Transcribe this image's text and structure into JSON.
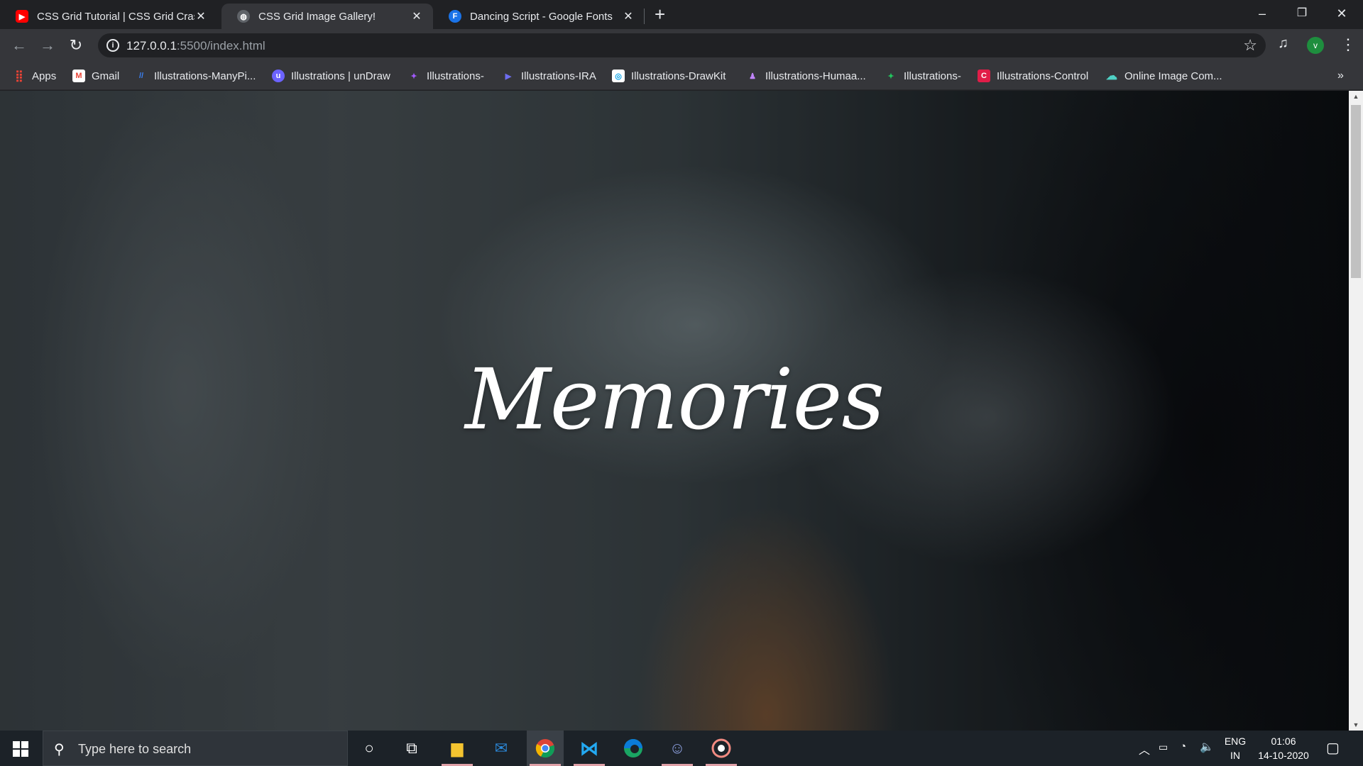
{
  "browser": {
    "tabs": [
      {
        "title": "CSS Grid Tutorial | CSS Grid Crash",
        "favicon": "youtube-icon",
        "favicon_color": "#ff0000",
        "active": false
      },
      {
        "title": "CSS Grid Image Gallery!",
        "favicon": "globe-icon",
        "favicon_color": "#5f6368",
        "active": true
      },
      {
        "title": "Dancing Script - Google Fonts",
        "favicon": "google-fonts-icon",
        "favicon_color": "#1a73e8",
        "favicon_letter": "F",
        "active": false
      }
    ],
    "new_tab_symbol": "+",
    "window_controls": {
      "minimize": "–",
      "restore": "❐",
      "close": "✕"
    },
    "address": {
      "host": "127.0.0.1",
      "path": ":5500/index.html"
    },
    "profile_initial": "v",
    "bookmarks": [
      {
        "label": "Apps",
        "icon": "apps-grid-icon",
        "color": "#4285f4"
      },
      {
        "label": "Gmail",
        "icon": "gmail-icon",
        "color": "#ea4335",
        "letter": "M"
      },
      {
        "label": "Illustrations-ManyPi...",
        "icon": "manypixels-icon",
        "color": "#3b82f6",
        "letter": "//"
      },
      {
        "label": "Illustrations | unDraw",
        "icon": "undraw-icon",
        "color": "#6c63ff",
        "letter": "u"
      },
      {
        "label": "Illustrations-",
        "icon": "figma-icon",
        "color": "#a259ff",
        "letter": "✦"
      },
      {
        "label": "Illustrations-IRA",
        "icon": "ira-icon",
        "color": "#5b5bd6",
        "letter": "▶"
      },
      {
        "label": "Illustrations-DrawKit",
        "icon": "drawkit-icon",
        "color": "#38bdf8",
        "letter": "◎"
      },
      {
        "label": "Illustrations-Humaa...",
        "icon": "humaaans-icon",
        "color": "#8b5cf6",
        "letter": "♟"
      },
      {
        "label": "Illustrations-",
        "icon": "figma-icon",
        "color": "#22c55e",
        "letter": "✦"
      },
      {
        "label": "Illustrations-Control",
        "icon": "control-icon",
        "color": "#e11d48",
        "letter": "C"
      },
      {
        "label": "Online Image Com...",
        "icon": "cloud-icon",
        "color": "#4fd1c5",
        "letter": "☁"
      }
    ],
    "bookmarks_overflow": "»"
  },
  "page": {
    "hero_title": "Memories"
  },
  "taskbar": {
    "search_placeholder": "Type here to search",
    "apps": [
      "cortana-icon",
      "task-view-icon",
      "file-explorer-icon",
      "mail-icon",
      "chrome-icon",
      "vscode-icon",
      "edge-icon",
      "discord-icon",
      "obs-icon"
    ],
    "language": {
      "line1": "ENG",
      "line2": "IN"
    },
    "clock": {
      "time": "01:06",
      "date": "14-10-2020"
    }
  }
}
